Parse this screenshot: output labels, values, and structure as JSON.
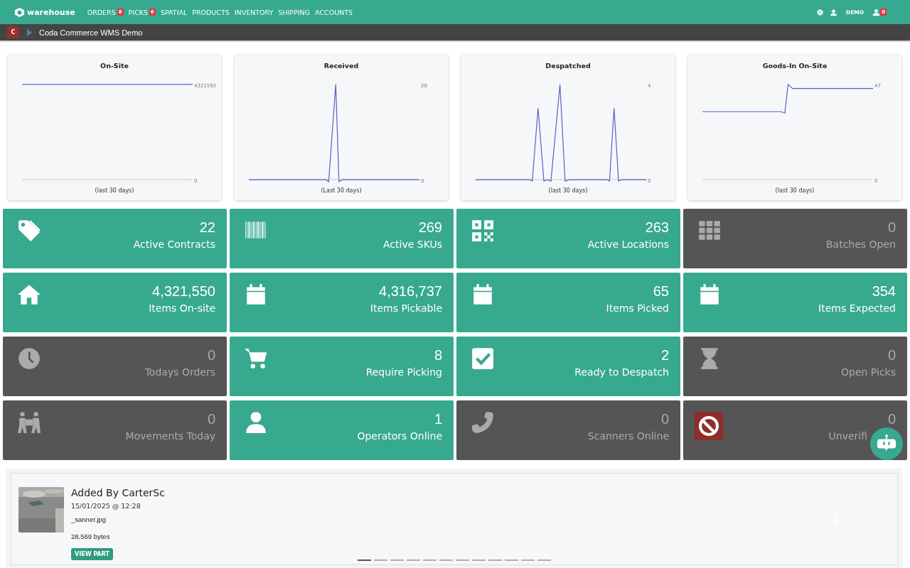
{
  "navbar": {
    "brand": "warehouse",
    "items": [
      {
        "label": "ORDERS",
        "badge": "8"
      },
      {
        "label": "PICKS",
        "badge": "6"
      },
      {
        "label": "SPATIAL"
      },
      {
        "label": "PRODUCTS"
      },
      {
        "label": "INVENTORY"
      },
      {
        "label": "SHIPPING"
      },
      {
        "label": "ACCOUNTS"
      }
    ],
    "user": "DEMO",
    "user_badge": "0"
  },
  "subbar": {
    "avatar": "C",
    "title": "Coda Commerce WMS Demo"
  },
  "charts": [
    {
      "title": "On-Site",
      "top_tick": "4321592",
      "bottom_tick": "0",
      "caption": "(last 30 days)"
    },
    {
      "title": "Received",
      "top_tick": "20",
      "bottom_tick": "0",
      "caption": "(Last 30 days)"
    },
    {
      "title": "Despatched",
      "top_tick": "4",
      "bottom_tick": "0",
      "caption": "(last 30 days)"
    },
    {
      "title": "Goods-In On-Site",
      "top_tick": "47",
      "bottom_tick": "0",
      "caption": "(last 30 days)"
    }
  ],
  "tiles": [
    {
      "value": "22",
      "label": "Active Contracts",
      "active": true,
      "alert": false
    },
    {
      "value": "269",
      "label": "Active SKUs",
      "active": true,
      "alert": false
    },
    {
      "value": "263",
      "label": "Active Locations",
      "active": true,
      "alert": false
    },
    {
      "value": "0",
      "label": "Batches Open",
      "active": false,
      "alert": false
    },
    {
      "value": "4,321,550",
      "label": "Items On-site",
      "active": true,
      "alert": false
    },
    {
      "value": "4,316,737",
      "label": "Items Pickable",
      "active": true,
      "alert": false
    },
    {
      "value": "65",
      "label": "Items Picked",
      "active": true,
      "alert": false
    },
    {
      "value": "354",
      "label": "Items Expected",
      "active": true,
      "alert": false
    },
    {
      "value": "0",
      "label": "Todays Orders",
      "active": false,
      "alert": false
    },
    {
      "value": "8",
      "label": "Require Picking",
      "active": true,
      "alert": false
    },
    {
      "value": "2",
      "label": "Ready to Despatch",
      "active": true,
      "alert": false
    },
    {
      "value": "0",
      "label": "Open Picks",
      "active": false,
      "alert": false
    },
    {
      "value": "0",
      "label": "Movements Today",
      "active": false,
      "alert": false
    },
    {
      "value": "1",
      "label": "Operators Online",
      "active": true,
      "alert": false
    },
    {
      "value": "0",
      "label": "Scanners Online",
      "active": false,
      "alert": false
    },
    {
      "value": "0",
      "label": "Unverifi",
      "active": false,
      "alert": true
    }
  ],
  "carousel": {
    "title": "Added By CarterSc",
    "date": "15/01/2025 @ 12:28",
    "file": "_sanner.jpg",
    "size": "28,569 bytes",
    "button": "VIEW PART",
    "slides": [
      {
        "selected": true
      },
      {
        "selected": false
      },
      {
        "selected": false
      },
      {
        "selected": false
      },
      {
        "selected": false
      },
      {
        "selected": false
      },
      {
        "selected": false
      },
      {
        "selected": false
      },
      {
        "selected": false
      },
      {
        "selected": false
      },
      {
        "selected": false
      },
      {
        "selected": false
      }
    ]
  }
}
